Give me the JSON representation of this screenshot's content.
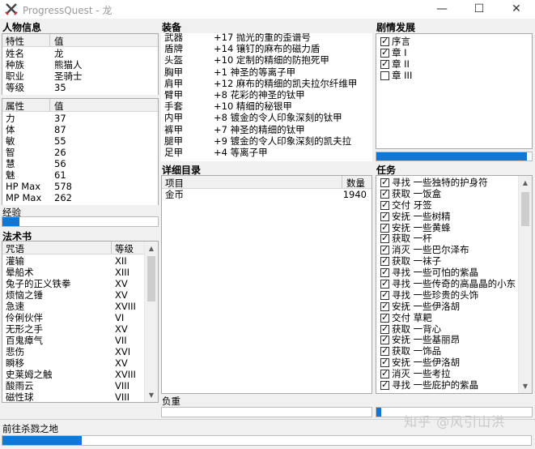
{
  "window": {
    "title": "ProgressQuest - 龙",
    "minimize": "—",
    "maximize": "☐",
    "close": "✕"
  },
  "character": {
    "section_label": "人物信息",
    "headers": [
      "特性",
      "值"
    ],
    "rows": [
      {
        "k": "姓名",
        "v": "龙"
      },
      {
        "k": "种族",
        "v": "熊猫人"
      },
      {
        "k": "职业",
        "v": "圣骑士"
      },
      {
        "k": "等级",
        "v": "35"
      }
    ]
  },
  "stats": {
    "headers": [
      "属性",
      "值"
    ],
    "rows": [
      {
        "k": "力",
        "v": "37"
      },
      {
        "k": "体",
        "v": "87"
      },
      {
        "k": "敏",
        "v": "55"
      },
      {
        "k": "智",
        "v": "26"
      },
      {
        "k": "慧",
        "v": "56"
      },
      {
        "k": "魅",
        "v": "61"
      },
      {
        "k": "HP Max",
        "v": "578"
      },
      {
        "k": "MP Max",
        "v": "262"
      }
    ]
  },
  "experience": {
    "label": "经验",
    "progress": 0.11
  },
  "spellbook": {
    "section_label": "法术书",
    "headers": [
      "咒语",
      "等级"
    ],
    "rows": [
      {
        "k": "灌输",
        "v": "XII"
      },
      {
        "k": "晕船术",
        "v": "XIII"
      },
      {
        "k": "兔子的正义铁拳",
        "v": "XV"
      },
      {
        "k": "烦恼之锤",
        "v": "XV"
      },
      {
        "k": "急速",
        "v": "XVIII"
      },
      {
        "k": "伶俐伙伴",
        "v": "VI"
      },
      {
        "k": "无形之手",
        "v": "XV"
      },
      {
        "k": "百鬼瘴气",
        "v": "VII"
      },
      {
        "k": "悲伤",
        "v": "XVI"
      },
      {
        "k": "瞬移",
        "v": "XV"
      },
      {
        "k": "史莱姆之触",
        "v": "XVIII"
      },
      {
        "k": "酸雨云",
        "v": "VIII"
      },
      {
        "k": "磁性球",
        "v": "VIII"
      }
    ]
  },
  "equipment": {
    "section_label": "装备",
    "rows": [
      {
        "k": "武器",
        "v": "+17 抛光的重的歪谱号"
      },
      {
        "k": "盾牌",
        "v": "+14 镶钉的麻布的磁力盾"
      },
      {
        "k": "头盔",
        "v": "+10 定制的精细的防抱死甲"
      },
      {
        "k": "胸甲",
        "v": "+1 神圣的等离子甲"
      },
      {
        "k": "肩甲",
        "v": "+12 麻布的精细的凯夫拉尔纤维甲"
      },
      {
        "k": "臂甲",
        "v": "+8 花彩的神圣的钛甲"
      },
      {
        "k": "手套",
        "v": "+10 精细的秘银甲"
      },
      {
        "k": "内甲",
        "v": "+8 镀金的令人印象深刻的钛甲"
      },
      {
        "k": "裤甲",
        "v": "+7 神圣的精细的钛甲"
      },
      {
        "k": "腿甲",
        "v": "+9 镀金的令人印象深刻的凯夫拉"
      },
      {
        "k": "足甲",
        "v": "+4 等离子甲"
      }
    ]
  },
  "inventory": {
    "section_label": "详细目录",
    "headers": [
      "项目",
      "数量"
    ],
    "rows": [
      {
        "k": "金币",
        "v": "1940"
      }
    ],
    "encumbrance_label": "负重",
    "encumbrance_progress": 0.0
  },
  "plot": {
    "section_label": "剧情发展",
    "items": [
      {
        "label": "序言",
        "checked": true
      },
      {
        "label": "章 I",
        "checked": true
      },
      {
        "label": "章 II",
        "checked": true
      },
      {
        "label": "章 III",
        "checked": false
      }
    ],
    "progress": 0.97
  },
  "quests": {
    "section_label": "任务",
    "items": [
      {
        "label": "寻找 一些独特的护身符",
        "checked": true
      },
      {
        "label": "获取 一饭盒",
        "checked": true
      },
      {
        "label": "交付 牙签",
        "checked": true
      },
      {
        "label": "安抚 一些树精",
        "checked": true
      },
      {
        "label": "安抚 一些黄蜂",
        "checked": true
      },
      {
        "label": "获取 一杆",
        "checked": true
      },
      {
        "label": "消灭 一些巴尔泽布",
        "checked": true
      },
      {
        "label": "获取 一袜子",
        "checked": true
      },
      {
        "label": "寻找 一些可怕的紫晶",
        "checked": true
      },
      {
        "label": "寻找 一些传奇的高晶晶的小东",
        "checked": true
      },
      {
        "label": "寻找 一些珍贵的头饰",
        "checked": true
      },
      {
        "label": "安抚 一些伊洛胡",
        "checked": true
      },
      {
        "label": "交付 草耙",
        "checked": true
      },
      {
        "label": "获取 一背心",
        "checked": true
      },
      {
        "label": "安抚 一些基丽昂",
        "checked": true
      },
      {
        "label": "获取 一饰品",
        "checked": true
      },
      {
        "label": "安抚 一些伊洛胡",
        "checked": true
      },
      {
        "label": "消灭 一些考拉",
        "checked": true
      },
      {
        "label": "寻找 一些庇护的紫晶",
        "checked": true
      }
    ],
    "progress": 0.03
  },
  "status": {
    "text": "前往杀戮之地",
    "progress": 0.15
  },
  "watermark": "知乎 @风引山洪",
  "colors": {
    "accent": "#0f78d7"
  },
  "icons": {
    "app": "crossed-swords-icon"
  }
}
